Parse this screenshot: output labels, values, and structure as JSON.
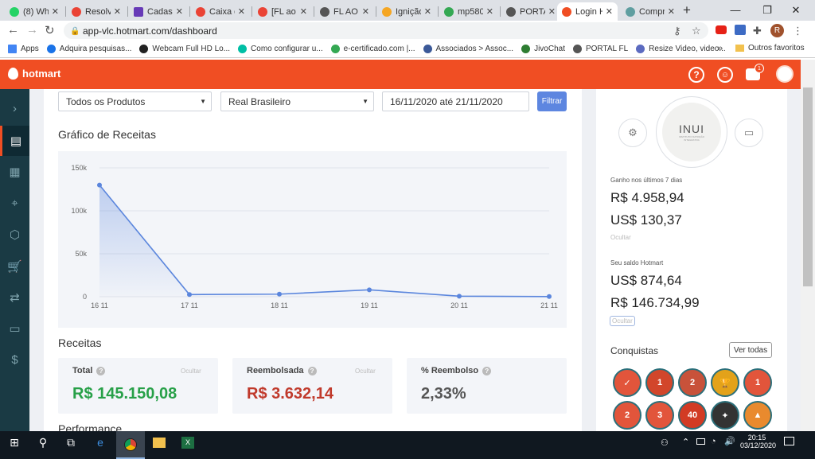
{
  "browser": {
    "tabs": [
      {
        "title": "(8) Wha",
        "color": "#25d366"
      },
      {
        "title": "Resolvi",
        "color": "#ea4335"
      },
      {
        "title": "Cadastr",
        "color": "#673ab7"
      },
      {
        "title": "Caixa d",
        "color": "#ea4335"
      },
      {
        "title": "[FL ao V",
        "color": "#ea4335"
      },
      {
        "title": "FL AO V",
        "color": "#555555"
      },
      {
        "title": "Ignição",
        "color": "#f5a623"
      },
      {
        "title": "mp580",
        "color": "#34a853"
      },
      {
        "title": "PORTAL",
        "color": "#555555"
      },
      {
        "title": "Login H",
        "color": "#f04e23"
      },
      {
        "title": "Compr",
        "color": "#5f9ea0"
      }
    ],
    "url": "app-vlc.hotmart.com/dashboard",
    "avatar_letter": "R",
    "bookmarks": [
      {
        "label": "Apps",
        "color": "#4285f4"
      },
      {
        "label": "Adquira pesquisas...",
        "color": "#1a73e8"
      },
      {
        "label": "Webcam Full HD Lo...",
        "color": "#222222"
      },
      {
        "label": "Como configurar u...",
        "color": "#00bfa5"
      },
      {
        "label": "e-certificado.com |...",
        "color": "#34a853"
      },
      {
        "label": "Associados > Assoc...",
        "color": "#3b5998"
      },
      {
        "label": "JivoChat",
        "color": "#2e7d32"
      },
      {
        "label": "PORTAL FL",
        "color": "#555555"
      },
      {
        "label": "Resize Video, video...",
        "color": "#5c6bc0"
      }
    ],
    "bookmarks_more": "»",
    "other_bookmarks": "Outros favoritos"
  },
  "hotmart": {
    "logo": "hotmart",
    "notif_count": "1"
  },
  "filters": {
    "product": "Todos os Produtos",
    "currency": "Real Brasileiro",
    "date_range": "16/11/2020 até 21/11/2020",
    "button": "Filtrar"
  },
  "chart_title": "Gráfico de Receitas",
  "chart_data": {
    "type": "area",
    "categories": [
      "16 11",
      "17 11",
      "18 11",
      "19 11",
      "20 11",
      "21 11"
    ],
    "values": [
      130000,
      2500,
      3000,
      8000,
      600,
      200
    ],
    "yticks": [
      "0",
      "50k",
      "100k",
      "150k"
    ],
    "ylim": [
      0,
      150000
    ],
    "color": "#5b86dd",
    "grid": true
  },
  "receitas": {
    "title": "Receitas",
    "ocultar": "Ocultar",
    "cards": [
      {
        "label": "Total",
        "value": "R$ 145.150,08",
        "color": "#27a048",
        "hide": true
      },
      {
        "label": "Reembolsada",
        "value": "R$ 3.632,14",
        "color": "#c0392b",
        "hide": true
      },
      {
        "label": "% Reembolso",
        "value": "2,33%",
        "color": "#555555",
        "hide": false
      }
    ]
  },
  "performance_title": "Performance",
  "right": {
    "logo_text": "INUI",
    "logo_sub": "INSTITUTO NUTRIÇÃO INTEGRATIVA",
    "gain_label": "Ganho nos últimos 7 dias",
    "gain_brl": "R$ 4.958,94",
    "gain_usd": "US$ 130,37",
    "ocultar": "Ocultar",
    "balance_label": "Seu saldo Hotmart",
    "balance_usd": "US$ 874,64",
    "balance_brl": "R$ 146.734,99",
    "conquistas": "Conquistas",
    "ver_todas": "Ver todas",
    "badges": [
      "✓",
      "1",
      "2",
      "🏆",
      "1",
      "2",
      "3",
      "40",
      "✦",
      "▲"
    ]
  },
  "taskbar": {
    "time": "20:15",
    "date": "03/12/2020"
  }
}
